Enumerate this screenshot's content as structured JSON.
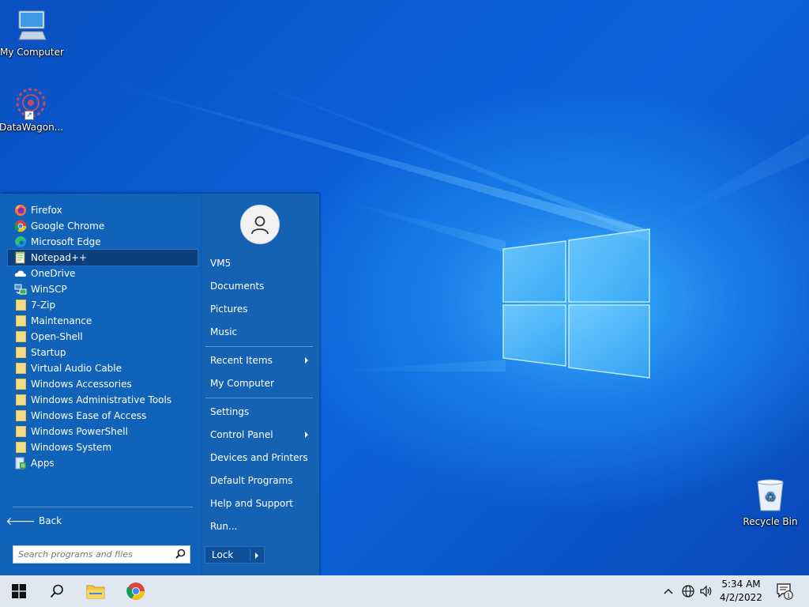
{
  "desktop": {
    "icons": [
      {
        "label": "My Computer",
        "icon": "monitor-icon"
      },
      {
        "label": "DataWagon...",
        "icon": "datawagon-icon"
      },
      {
        "label": "Recycle Bin",
        "icon": "recycle-bin-icon"
      }
    ]
  },
  "start_menu": {
    "programs": [
      {
        "label": "Firefox",
        "icon": "firefox-icon"
      },
      {
        "label": "Google Chrome",
        "icon": "chrome-icon"
      },
      {
        "label": "Microsoft Edge",
        "icon": "edge-icon"
      },
      {
        "label": "Notepad++",
        "icon": "notepadpp-icon",
        "selected": true
      },
      {
        "label": "OneDrive",
        "icon": "onedrive-icon"
      },
      {
        "label": "WinSCP",
        "icon": "winscp-icon"
      },
      {
        "label": "7-Zip",
        "icon": "folder-icon"
      },
      {
        "label": "Maintenance",
        "icon": "folder-icon"
      },
      {
        "label": "Open-Shell",
        "icon": "folder-icon"
      },
      {
        "label": "Startup",
        "icon": "folder-icon"
      },
      {
        "label": "Virtual Audio Cable",
        "icon": "folder-icon"
      },
      {
        "label": "Windows Accessories",
        "icon": "folder-icon"
      },
      {
        "label": "Windows Administrative Tools",
        "icon": "folder-icon"
      },
      {
        "label": "Windows Ease of Access",
        "icon": "folder-icon"
      },
      {
        "label": "Windows PowerShell",
        "icon": "folder-icon"
      },
      {
        "label": "Windows System",
        "icon": "folder-icon"
      },
      {
        "label": "Apps",
        "icon": "apps-icon"
      }
    ],
    "back_label": "Back",
    "search_placeholder": "Search programs and files",
    "right_items": [
      {
        "label": "VM5",
        "submenu": false
      },
      {
        "label": "Documents",
        "submenu": false
      },
      {
        "label": "Pictures",
        "submenu": false
      },
      {
        "label": "Music",
        "submenu": false
      },
      {
        "label": "Recent Items",
        "submenu": true
      },
      {
        "label": "My Computer",
        "submenu": false
      },
      {
        "label": "Settings",
        "submenu": false
      },
      {
        "label": "Control Panel",
        "submenu": true
      },
      {
        "label": "Devices and Printers",
        "submenu": false
      },
      {
        "label": "Default Programs",
        "submenu": false
      },
      {
        "label": "Help and Support",
        "submenu": false
      },
      {
        "label": "Run...",
        "submenu": false
      }
    ],
    "lock_label": "Lock"
  },
  "taskbar": {
    "pinned": [
      {
        "name": "start-button",
        "icon": "windows-logo-icon"
      },
      {
        "name": "search-button",
        "icon": "search-icon"
      },
      {
        "name": "file-explorer-button",
        "icon": "folder-icon"
      },
      {
        "name": "chrome-taskbar-button",
        "icon": "chrome-icon"
      }
    ],
    "tray": {
      "time": "5:34 AM",
      "date": "4/2/2022",
      "notification_count": "1"
    }
  },
  "colors": {
    "menu_bg": "#1063b8",
    "menu_right_bg": "#1562b4",
    "selected_bg": "#0b3f7e",
    "taskbar_bg": "#dfe7f2",
    "desktop_blue": "#0b63dc"
  }
}
